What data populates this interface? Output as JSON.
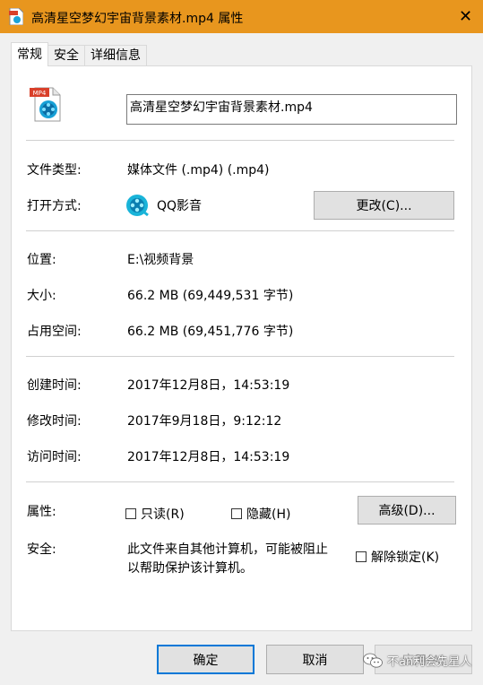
{
  "window": {
    "title": "高清星空梦幻宇宙背景素材.mp4 属性",
    "close_glyph": "✕",
    "accent_color": "#e8961e"
  },
  "tabs": [
    {
      "label": "常规",
      "active": true
    },
    {
      "label": "安全",
      "active": false
    },
    {
      "label": "详细信息",
      "active": false
    }
  ],
  "file": {
    "icon": "mp4-file-icon",
    "icon_badge": "MP4",
    "name": "高清星空梦幻宇宙背景素材.mp4"
  },
  "type_section": {
    "file_type_label": "文件类型:",
    "file_type_value": "媒体文件 (.mp4) (.mp4)",
    "open_with_label": "打开方式:",
    "open_with_app": "QQ影音",
    "open_with_icon": "qq-player-icon",
    "change_button": "更改(C)..."
  },
  "location_section": {
    "location_label": "位置:",
    "location_value": "E:\\视频背景",
    "size_label": "大小:",
    "size_value": "66.2 MB (69,449,531 字节)",
    "disk_size_label": "占用空间:",
    "disk_size_value": "66.2 MB (69,451,776 字节)"
  },
  "dates_section": {
    "created_label": "创建时间:",
    "created_value": "2017年12月8日，14:53:19",
    "modified_label": "修改时间:",
    "modified_value": "2017年9月18日，9:12:12",
    "accessed_label": "访问时间:",
    "accessed_value": "2017年12月8日，14:53:19"
  },
  "attributes_section": {
    "attributes_label": "属性:",
    "readonly_label": "只读(R)",
    "readonly_checked": false,
    "hidden_label": "隐藏(H)",
    "hidden_checked": false,
    "advanced_button": "高级(D)...",
    "security_label": "安全:",
    "security_text_line1": "此文件来自其他计算机，可能被阻止",
    "security_text_line2": "以帮助保护该计算机。",
    "unblock_label": "解除锁定(K)",
    "unblock_checked": false
  },
  "footer": {
    "ok_button": "确定",
    "cancel_button": "取消",
    "apply_button": "应用(A)"
  },
  "watermark": {
    "text": "不an利会先星人",
    "icon": "wechat-icon"
  }
}
